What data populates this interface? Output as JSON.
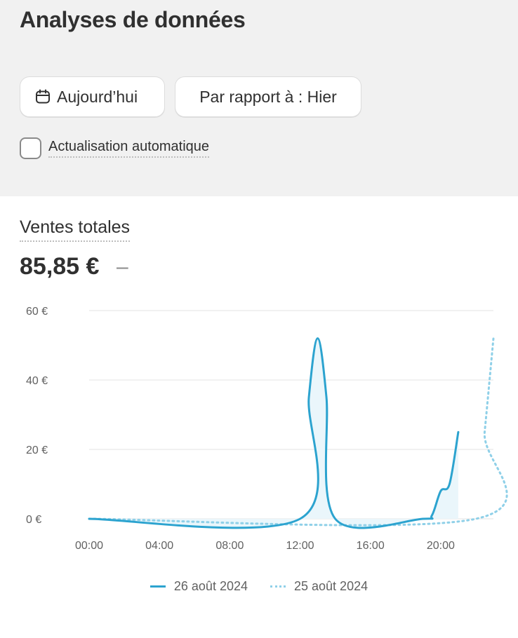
{
  "header": {
    "title": "Analyses de données"
  },
  "controls": {
    "date_icon": "calendar-icon",
    "date_label": "Aujourd’hui",
    "compare_label": "Par rapport à : Hier",
    "auto_refresh_label": "Actualisation automatique",
    "auto_refresh_checked": false
  },
  "metric": {
    "title": "Ventes totales",
    "value": "85,85 €",
    "change": "–"
  },
  "colors": {
    "primary_series": "#2ca3cf",
    "comparison_series": "#8fd0e8",
    "area_fill": "#eaf6fb",
    "grid": "#e3e3e3"
  },
  "chart_data": {
    "type": "line",
    "y_ticks": [
      "0 €",
      "20 €",
      "40 €",
      "60 €"
    ],
    "x_ticks": [
      "00:00",
      "04:00",
      "08:00",
      "12:00",
      "16:00",
      "20:00"
    ],
    "ylim": [
      0,
      60
    ],
    "xlim_hours": [
      0,
      23
    ],
    "grid": true,
    "legend_placement": "bottom",
    "series": [
      {
        "name": "26 août 2024",
        "style": "solid",
        "x_hours": [
          0,
          12,
          12.5,
          13,
          13.5,
          14,
          19,
          19.5,
          20,
          20.5,
          21
        ],
        "values": [
          0,
          0,
          35,
          52,
          35,
          0,
          0,
          1,
          8,
          10,
          25
        ]
      },
      {
        "name": "25 août 2024",
        "style": "dotted",
        "x_hours": [
          0,
          22,
          22.5,
          23
        ],
        "values": [
          0,
          0,
          25,
          52
        ]
      }
    ]
  }
}
